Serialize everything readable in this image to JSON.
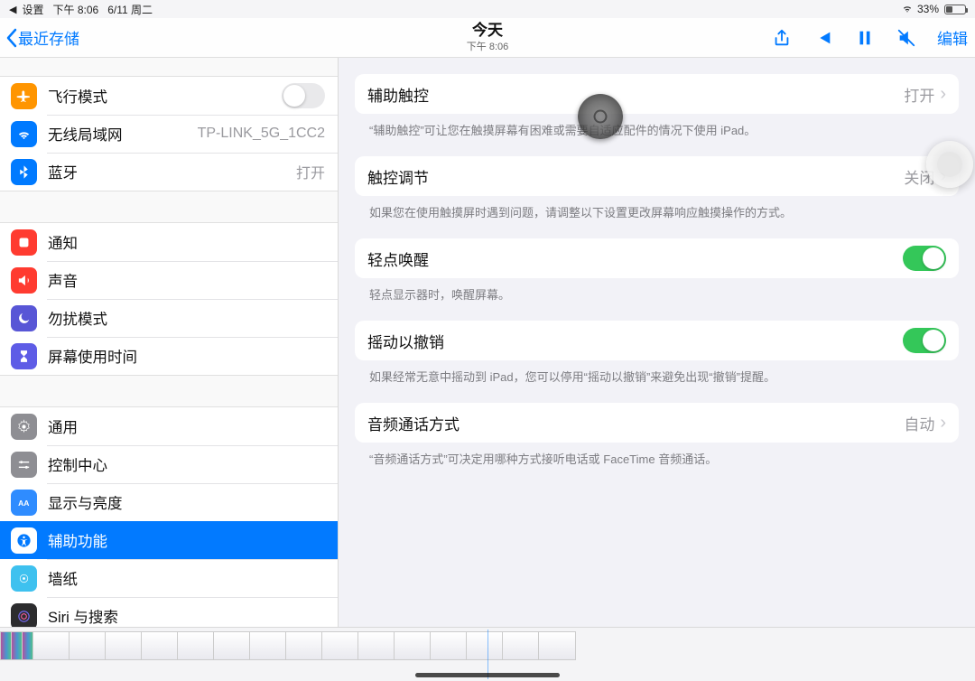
{
  "status": {
    "back_app": "设置",
    "time": "下午 8:06",
    "date": "6/11 周二",
    "battery": "33%"
  },
  "nav": {
    "back": "最近存储",
    "title": "今天",
    "subtitle": "下午 8:06",
    "edit": "编辑"
  },
  "sidebar": {
    "group1": {
      "airplane": "飞行模式",
      "wifi": "无线局域网",
      "wifi_value": "TP-LINK_5G_1CC2",
      "bluetooth": "蓝牙",
      "bluetooth_value": "打开"
    },
    "group2": {
      "notifications": "通知",
      "sounds": "声音",
      "dnd": "勿扰模式",
      "screentime": "屏幕使用时间"
    },
    "group3": {
      "general": "通用",
      "controlcenter": "控制中心",
      "display": "显示与亮度",
      "accessibility": "辅助功能",
      "wallpaper": "墙纸",
      "siri": "Siri 与搜索"
    }
  },
  "detail": {
    "assistive_touch": {
      "label": "辅助触控",
      "value": "打开"
    },
    "assistive_touch_footer": "“辅助触控”可让您在触摸屏幕有困难或需要自适应配件的情况下使用 iPad。",
    "touch_accommodations": {
      "label": "触控调节",
      "value": "关闭"
    },
    "touch_accommodations_footer": "如果您在使用触摸屏时遇到问题，请调整以下设置更改屏幕响应触摸操作的方式。",
    "tap_to_wake": {
      "label": "轻点唤醒"
    },
    "tap_to_wake_footer": "轻点显示器时，唤醒屏幕。",
    "shake_to_undo": {
      "label": "摇动以撤销"
    },
    "shake_to_undo_footer": "如果经常无意中摇动到 iPad，您可以停用“摇动以撤销”来避免出现“撤销”提醒。",
    "call_audio": {
      "label": "音频通话方式",
      "value": "自动"
    },
    "call_audio_footer": "“音频通话方式”可决定用哪种方式接听电话或 FaceTime 音频通话。"
  }
}
